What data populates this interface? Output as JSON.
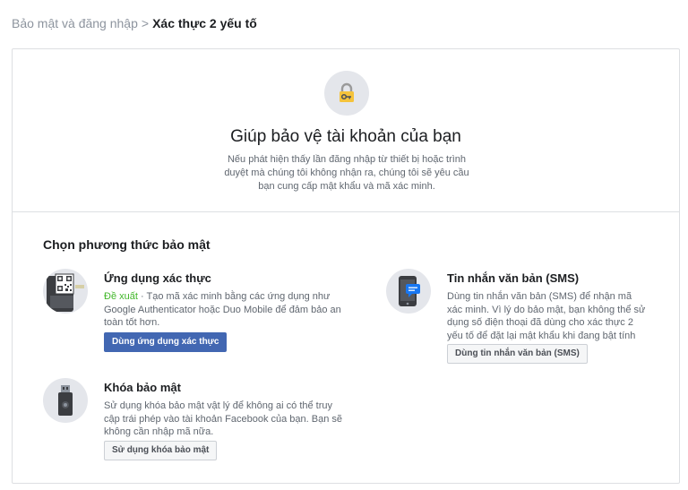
{
  "breadcrumb": {
    "parent": "Bảo mật và đăng nhập",
    "separator": ">",
    "current": "Xác thực 2 yếu tố"
  },
  "hero": {
    "icon": "lock-key-icon",
    "title": "Giúp bảo vệ tài khoản của bạn",
    "description": "Nếu phát hiện thấy lần đăng nhập từ thiết bị hoặc trình duyệt mà chúng tôi không nhận ra, chúng tôi sẽ yêu cầu bạn cung cấp mật khẩu và mã xác minh."
  },
  "methods_section": {
    "title": "Chọn phương thức bảo mật",
    "auth_app": {
      "icon": "qr-phone-icon",
      "title": "Ứng dụng xác thực",
      "recommended": "Đề xuất",
      "description": " · Tạo mã xác minh bằng các ứng dụng như Google Authenticator hoặc Duo Mobile để đảm bảo an toàn tốt hơn.",
      "button_label": "Dùng ứng dụng xác thực"
    },
    "sms": {
      "icon": "phone-message-icon",
      "title": "Tin nhắn văn bản (SMS)",
      "description": "Dùng tin nhắn văn bản (SMS) để nhận mã xác minh. Vì lý do bảo mật, bạn không thể sử dụng số điện thoại đã dùng cho xác thực 2 yếu tố để đặt lại mật khẩu khi đang bật tính năng này.",
      "button_label": "Dùng tin nhắn văn bản (SMS)"
    },
    "security_key": {
      "icon": "usb-key-icon",
      "title": "Khóa bảo mật",
      "description": "Sử dụng khóa bảo mật vật lý để không ai có thể truy cập trái phép vào tài khoản Facebook của bạn. Bạn sẽ không cần nhập mã nữa.",
      "button_label": "Sử dụng khóa bảo mật"
    }
  },
  "colors": {
    "primary_button": "#4267b2",
    "recommended": "#42b72a",
    "lock_gold": "#f5c33b"
  }
}
